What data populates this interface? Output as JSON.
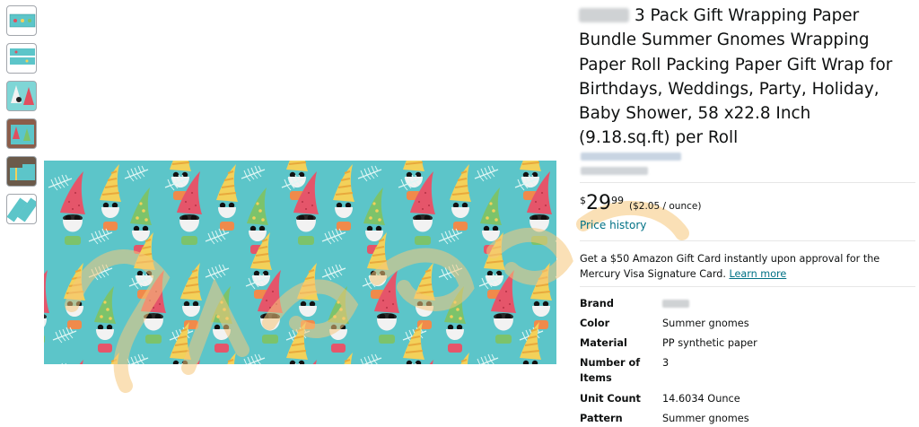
{
  "product": {
    "title": "3 Pack Gift Wrapping Paper Bundle Summer Gnomes Wrapping Paper Roll Packing Paper Gift Wrap for Birthdays, Weddings, Party, Holiday, Baby Shower, 58 x22.8 Inch (9.18.sq.ft) per Roll"
  },
  "price": {
    "symbol": "$",
    "whole": "29",
    "fraction": "99",
    "unit_price": "($2.05 / ounce)",
    "history_link": "Price history"
  },
  "promo": {
    "text": "Get a $50 Amazon Gift Card instantly upon approval for the Mercury Visa Signature Card.",
    "link": "Learn more"
  },
  "specs": [
    {
      "key": "Brand",
      "value": ""
    },
    {
      "key": "Color",
      "value": "Summer gnomes"
    },
    {
      "key": "Material",
      "value": "PP synthetic paper"
    },
    {
      "key": "Number of Items",
      "value": "3"
    },
    {
      "key": "Unit Count",
      "value": "14.6034 Ounce"
    },
    {
      "key": "Pattern",
      "value": "Summer gnomes"
    }
  ],
  "thumbnails": [
    "thumbnail-roll-1",
    "thumbnail-roll-2",
    "thumbnail-gnome-closeup",
    "thumbnail-wrapped-gift",
    "thumbnail-gift-boxes",
    "thumbnail-rolled-paper"
  ],
  "colors": {
    "link": "#007185",
    "paper_background": "#5cc5c9",
    "watermark": "#f5c77a"
  }
}
